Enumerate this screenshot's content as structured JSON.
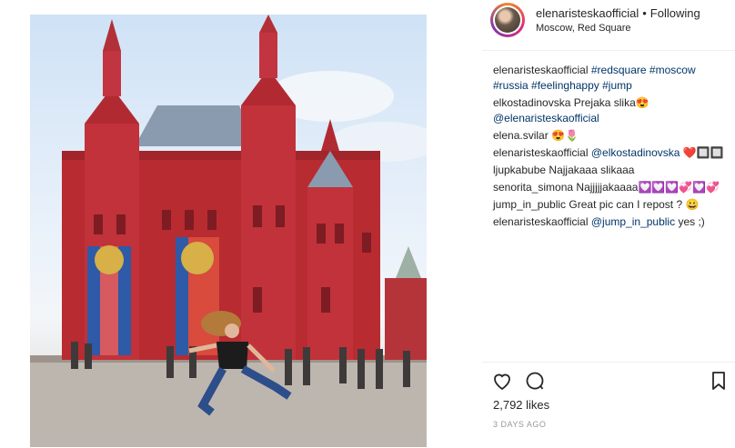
{
  "header": {
    "username": "elenaristeskaofficial",
    "separator": "•",
    "follow_status": "Following",
    "location": "Moscow, Red Square"
  },
  "comments": [
    {
      "user": "elenaristeskaofficial",
      "parts": [
        "#redsquare",
        "#moscow",
        "#russia",
        "#feelinghappy",
        "#jump"
      ]
    },
    {
      "user": "elkostadinovska",
      "text": "Prejaka slika😍",
      "mention": "@elenaristeskaofficial"
    },
    {
      "user": "elena.svilar",
      "text": "😍🌷"
    },
    {
      "user": "elenaristeskaofficial",
      "mention": "@elkostadinovska",
      "text": "❤️🔲🔲"
    },
    {
      "user": "ljupkabube",
      "text": "Najjakaaa slikaaa"
    },
    {
      "user": "senorita_simona",
      "text": "Najjjjjakaaaa💟💟💟💞💟💞"
    },
    {
      "user": "jump_in_public",
      "text": "Great pic can I repost ? 😀"
    },
    {
      "user": "elenaristeskaofficial",
      "mention": "@jump_in_public",
      "text": "yes ;)"
    }
  ],
  "icons": {
    "heart": "heart-icon",
    "comment": "comment-icon",
    "bookmark": "bookmark-icon"
  },
  "likes": "2,792 likes",
  "time": "3 DAYS AGO",
  "colors": {
    "tag": "#003569",
    "muted": "#999999",
    "text": "#262626"
  }
}
